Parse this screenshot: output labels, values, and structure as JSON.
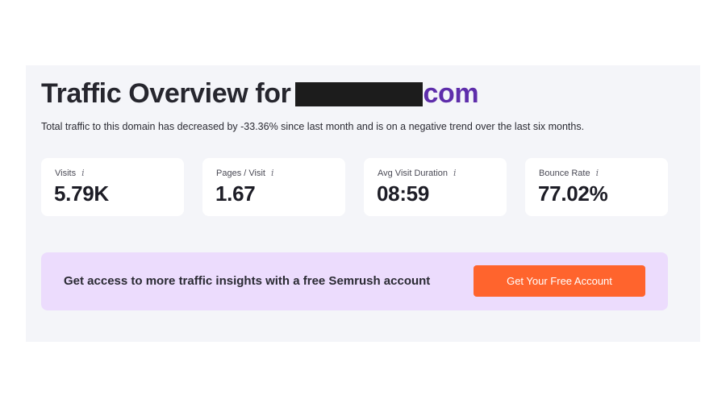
{
  "header": {
    "title_prefix": "Traffic Overview for",
    "domain_suffix": "com",
    "subtitle": "Total traffic to this domain has decreased by -33.36% since last month and is on a negative trend over the last six months."
  },
  "metrics": [
    {
      "label": "Visits",
      "value": "5.79K",
      "icon": "info-icon"
    },
    {
      "label": "Pages / Visit",
      "value": "1.67",
      "icon": "info-icon"
    },
    {
      "label": "Avg Visit Duration",
      "value": "08:59",
      "icon": "info-icon"
    },
    {
      "label": "Bounce Rate",
      "value": "77.02%",
      "icon": "info-icon"
    }
  ],
  "info_icon_glyph": "i",
  "banner": {
    "text": "Get access to more traffic insights with a free Semrush account",
    "button_label": "Get Your Free Account"
  },
  "colors": {
    "domain_accent": "#5e2dab",
    "banner_bg": "#ecdcfd",
    "button_bg": "#ff642d",
    "panel_bg": "#f4f5f9"
  }
}
